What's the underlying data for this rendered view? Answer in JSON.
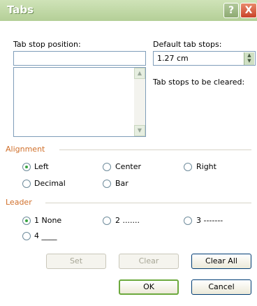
{
  "window": {
    "title": "Tabs",
    "help_glyph": "?",
    "close_glyph": "X"
  },
  "tab_stop_position": {
    "label": "Tab stop position:",
    "value": ""
  },
  "default_tab_stops": {
    "label": "Default tab stops:",
    "value": "1.27 cm"
  },
  "tab_stops_to_be_cleared": {
    "label": "Tab stops to be cleared:"
  },
  "alignment": {
    "title": "Alignment",
    "options": [
      {
        "label": "Left",
        "checked": true
      },
      {
        "label": "Center",
        "checked": false
      },
      {
        "label": "Right",
        "checked": false
      },
      {
        "label": "Decimal",
        "checked": false
      },
      {
        "label": "Bar",
        "checked": false
      }
    ]
  },
  "leader": {
    "title": "Leader",
    "options": [
      {
        "label": "1 None",
        "checked": true
      },
      {
        "label": "2 .......",
        "checked": false
      },
      {
        "label": "3 -------",
        "checked": false
      },
      {
        "label": "4 ____",
        "checked": false
      }
    ]
  },
  "buttons": {
    "set": "Set",
    "clear": "Clear",
    "clear_all": "Clear All",
    "ok": "OK",
    "cancel": "Cancel"
  },
  "colors": {
    "group_title": "#d06f2a",
    "titlebar": "#b4cf97"
  }
}
